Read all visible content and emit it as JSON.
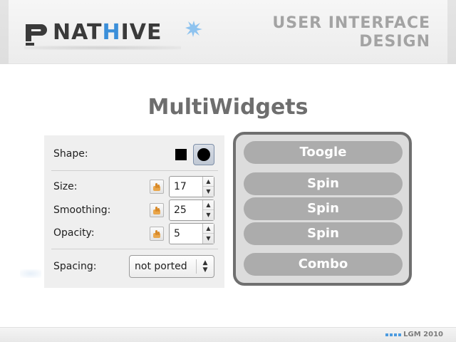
{
  "header": {
    "brand": {
      "prefix": "NAT",
      "highlight": "H",
      "suffix": "IVE"
    },
    "title_line1": "USER INTERFACE",
    "title_line2": "DESIGN"
  },
  "page_title": "MultiWidgets",
  "panel": {
    "shape_label": "Shape:",
    "shape_options": [
      "square",
      "circle"
    ],
    "shape_selected": "circle",
    "size_label": "Size:",
    "size_value": "17",
    "smoothing_label": "Smoothing:",
    "smoothing_value": "25",
    "opacity_label": "Opacity:",
    "opacity_value": "5",
    "spacing_label": "Spacing:",
    "spacing_value": "not ported"
  },
  "right_panel": {
    "toggle_label": "Toogle",
    "spin1_label": "Spin",
    "spin2_label": "Spin",
    "spin3_label": "Spin",
    "combo_label": "Combo"
  },
  "footer": {
    "text": "LGM 2010"
  },
  "colors": {
    "accent": "#3b8fd9",
    "pill": "#acacac",
    "panel_border": "#6f6f6f",
    "title_gray": "#6e6e6e"
  },
  "icons": [
    "nathive-logo-icon",
    "square-shape-icon",
    "circle-shape-icon",
    "chain-link-icon",
    "spin-up-arrow-icon",
    "spin-down-arrow-icon",
    "combo-arrows-icon",
    "footer-dots-icon"
  ]
}
